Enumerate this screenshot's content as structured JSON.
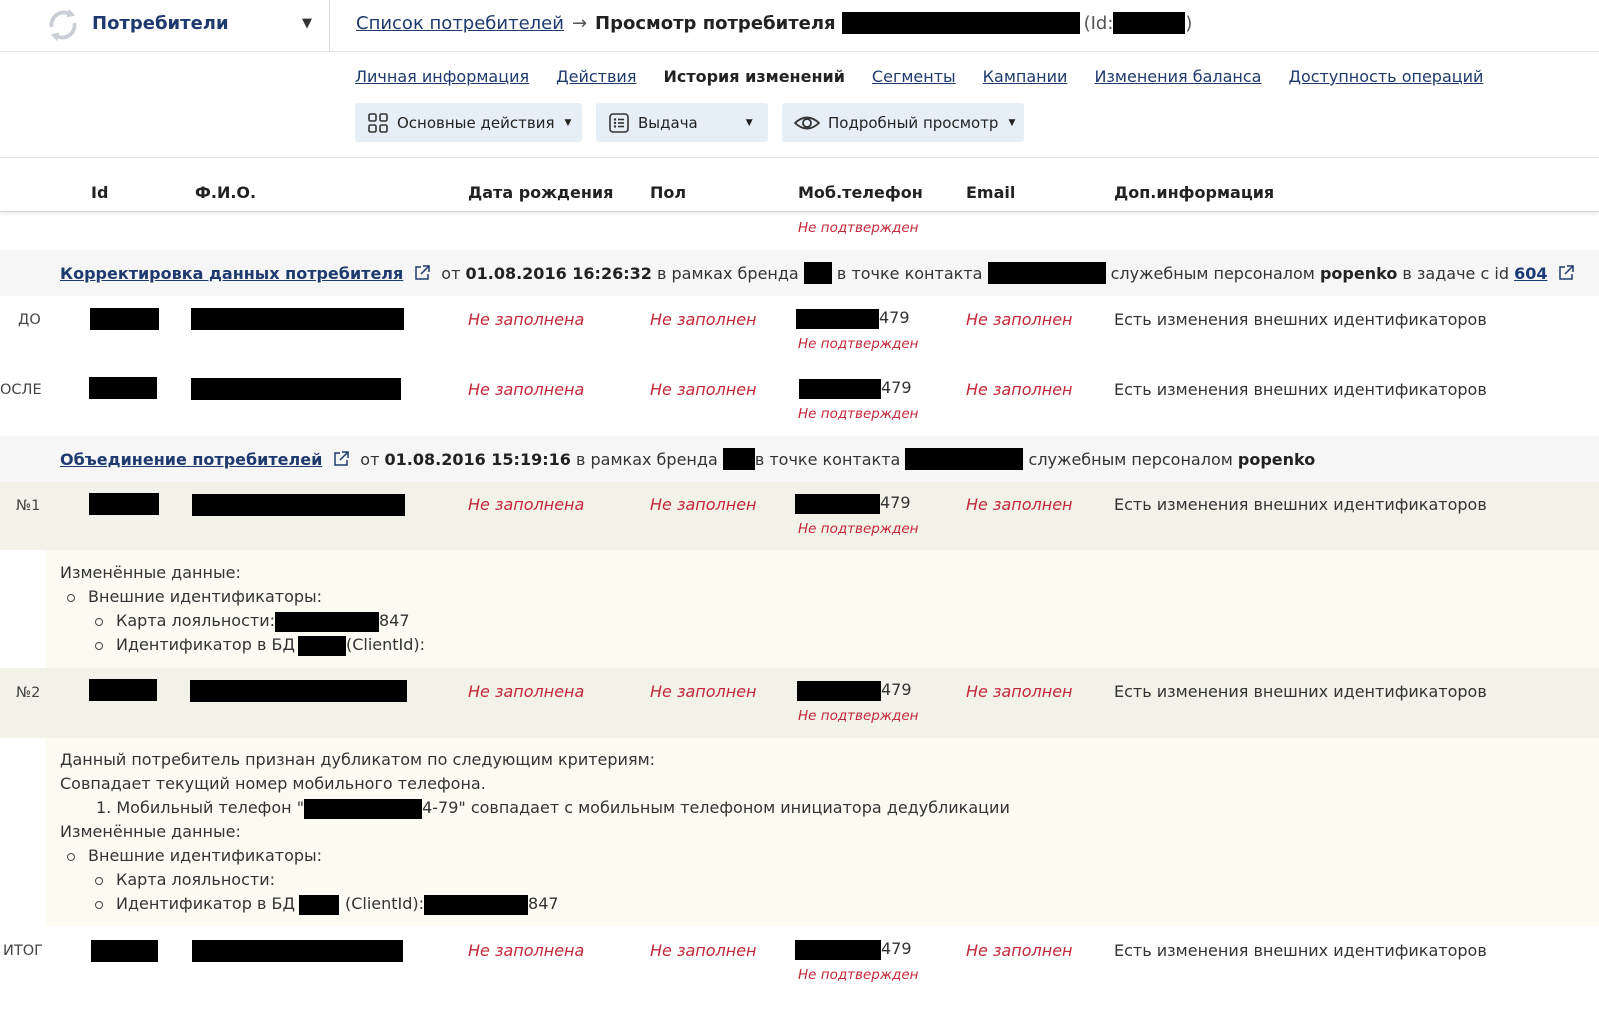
{
  "topbar": {
    "section_title": "Потребители",
    "breadcrumb_link": "Список потребителей",
    "breadcrumb_arrow": "→",
    "breadcrumb_current": "Просмотр потребителя",
    "id_prefix": "(Id:",
    "id_suffix": ")"
  },
  "tabs": [
    {
      "label": "Личная информация",
      "active": false
    },
    {
      "label": "Действия",
      "active": false
    },
    {
      "label": "История изменений",
      "active": true
    },
    {
      "label": "Сегменты",
      "active": false
    },
    {
      "label": "Кампании",
      "active": false
    },
    {
      "label": "Изменения баланса",
      "active": false
    },
    {
      "label": "Доступность операций",
      "active": false
    }
  ],
  "buttons": {
    "main_actions": "Основные действия",
    "issue": "Выдача",
    "detailed_view": "Подробный просмотр"
  },
  "columns": {
    "id": "Id",
    "fio": "Ф.И.О.",
    "birth": "Дата рождения",
    "gender": "Пол",
    "phone": "Моб.телефон",
    "email": "Email",
    "extra": "Доп.информация"
  },
  "values": {
    "birth_empty": "Не заполнена",
    "gender_empty": "Не заполнен",
    "email_empty": "Не заполнен",
    "phone_suffix": "479",
    "phone_unconfirmed": "Не подтвержден",
    "extra_info": "Есть изменения внешних идентификаторов"
  },
  "event1": {
    "title": "Корректировка данных потребителя",
    "from": "от",
    "datetime": "01.08.2016 16:26:32",
    "brand_text": "в рамках бренда",
    "contact_text": "в точке контакта",
    "staff_text": "служебным персоналом",
    "staff_name": "popenko",
    "task_text": "в задаче с id",
    "task_id": "604",
    "label_before": "ДО",
    "label_after": "ОСЛЕ"
  },
  "event2": {
    "title": "Объединение потребителей",
    "from": "от",
    "datetime": "01.08.2016 15:19:16",
    "brand_text": "в рамках бренда",
    "contact_text": "в точке контакта",
    "staff_text": "служебным персоналом",
    "staff_name": "popenko",
    "label_n1": "№1",
    "label_n2": "№2",
    "label_total": "ИТОГ"
  },
  "details1": {
    "changed": "Изменённые данные:",
    "ext_ids": "Внешние идентификаторы:",
    "loyalty_card": "Карта лояльности:",
    "loyalty_suffix": "847",
    "db_id": "Идентификатор в БД",
    "client_id": "(ClientId):"
  },
  "details2": {
    "duplicate": "Данный потребитель признан дубликатом по следующим критериям:",
    "criteria": "Совпадает текущий номер мобильного телефона.",
    "item_prefix": "1. Мобильный телефон \"",
    "item_suffix": "4-79\" совпадает с мобильным телефоном инициатора дедубликации",
    "changed": "Изменённые данные:",
    "ext_ids": "Внешние идентификаторы:",
    "loyalty_card": "Карта лояльности:",
    "db_id": "Идентификатор в БД",
    "client_id": "(ClientId):",
    "client_suffix": "847"
  }
}
